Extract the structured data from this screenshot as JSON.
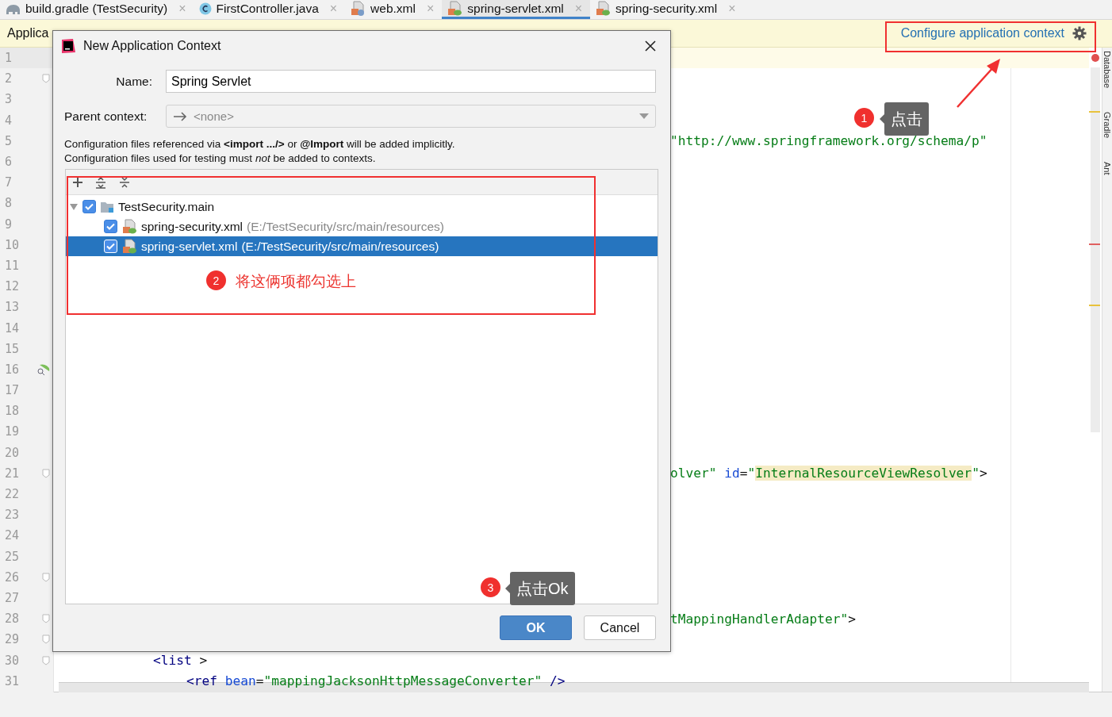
{
  "tabs": [
    {
      "label": "build.gradle (TestSecurity)",
      "kind": "gradle",
      "close": "×",
      "selected": false
    },
    {
      "label": "FirstController.java",
      "kind": "java",
      "close": "×",
      "selected": false
    },
    {
      "label": "web.xml",
      "kind": "web-xml",
      "close": "×",
      "selected": false
    },
    {
      "label": "spring-servlet.xml",
      "kind": "spring-xml",
      "close": "×",
      "selected": true
    },
    {
      "label": "spring-security.xml",
      "kind": "spring-xml",
      "close": "×",
      "selected": false
    }
  ],
  "banner": {
    "text": "Applica",
    "link": "Configure application context"
  },
  "right_toolbar": [
    "Database",
    "Gradle",
    "Ant"
  ],
  "editor": {
    "lines": [
      {
        "number": "1",
        "current": true
      },
      {
        "number": "2",
        "kind": "fold",
        "current": false
      },
      {
        "number": "3",
        "current": false
      },
      {
        "number": "4",
        "current": false
      },
      {
        "number": "5",
        "current": false,
        "code": [
          {
            "kind": "string",
            "text": "\"http://www.springframework.org/schema/p\""
          }
        ]
      },
      {
        "number": "6",
        "current": false
      },
      {
        "number": "7",
        "current": false
      },
      {
        "number": "8",
        "current": false
      },
      {
        "number": "9",
        "current": false
      },
      {
        "number": "10",
        "current": false
      },
      {
        "number": "11",
        "current": false
      },
      {
        "number": "12",
        "current": false
      },
      {
        "number": "13",
        "current": false
      },
      {
        "number": "14",
        "current": false
      },
      {
        "number": "15",
        "current": false
      },
      {
        "number": "16",
        "kind": "bean",
        "current": false
      },
      {
        "number": "17",
        "current": false
      },
      {
        "number": "18",
        "current": false
      },
      {
        "number": "19",
        "current": false
      },
      {
        "number": "20",
        "current": false
      },
      {
        "number": "21",
        "kind": "fold",
        "current": false,
        "code": [
          {
            "kind": "string",
            "text": "olver\" "
          },
          {
            "kind": "attr",
            "text": "id"
          },
          {
            "kind": "plain",
            "text": "="
          },
          {
            "kind": "string",
            "text": "\""
          },
          {
            "kind": "match",
            "text": "InternalResourceViewResolver"
          },
          {
            "kind": "string",
            "text": "\""
          },
          {
            "kind": "plain",
            "text": ">"
          }
        ]
      },
      {
        "number": "22",
        "current": false
      },
      {
        "number": "23",
        "current": false
      },
      {
        "number": "24",
        "current": false
      },
      {
        "number": "25",
        "current": false
      },
      {
        "number": "26",
        "kind": "fold",
        "current": false
      },
      {
        "number": "27",
        "current": false
      },
      {
        "number": "28",
        "kind": "fold",
        "current": false,
        "code": [
          {
            "kind": "string",
            "text": "tMappingHandlerAdapter\""
          },
          {
            "kind": "plain",
            "text": ">"
          }
        ]
      },
      {
        "number": "29",
        "kind": "fold",
        "current": false
      },
      {
        "number": "30",
        "kind": "fold",
        "current": false,
        "code": [
          {
            "kind": "tag",
            "text": "<list "
          },
          {
            "kind": "plain",
            "text": ">"
          }
        ]
      },
      {
        "number": "31",
        "current": false,
        "code": [
          {
            "kind": "tag",
            "text": "<ref "
          },
          {
            "kind": "attr",
            "text": "bean"
          },
          {
            "kind": "plain",
            "text": "="
          },
          {
            "kind": "string",
            "text": "\"mappingJacksonHttpMessageConverter\" "
          },
          {
            "kind": "tag",
            "text": "/>"
          }
        ]
      }
    ]
  },
  "dialog": {
    "title": "New Application Context",
    "name": {
      "label": "Name:",
      "value": "Spring Servlet"
    },
    "parent": {
      "label": "Parent context:",
      "value": "<none>",
      "disabled": true
    },
    "info": [
      "Configuration files referenced via **<import .../>** or **@Import** will be added implicitly.",
      "Configuration files used for testing must *not* be added to contexts."
    ],
    "tree": [
      {
        "label": "TestSecurity.main",
        "kind": "module",
        "checked": true,
        "selected": false,
        "expanded": true,
        "children": [
          {
            "label": "spring-security.xml",
            "path": "(E:/TestSecurity/src/main/resources)",
            "kind": "file",
            "checked": true,
            "selected": false
          },
          {
            "label": "spring-servlet.xml",
            "path": "(E:/TestSecurity/src/main/resources)",
            "kind": "file",
            "checked": true,
            "selected": true
          }
        ]
      }
    ],
    "buttons": [
      {
        "label": "OK",
        "kind": "primary"
      },
      {
        "label": "Cancel",
        "kind": "secondary"
      }
    ]
  },
  "annotations": [
    {
      "kind": "tooltip",
      "number": "1",
      "text": "点击"
    },
    {
      "kind": "note",
      "number": "2",
      "text": "将这俩项都勾选上"
    },
    {
      "kind": "tooltip",
      "number": "3",
      "text": "点击Ok"
    }
  ]
}
